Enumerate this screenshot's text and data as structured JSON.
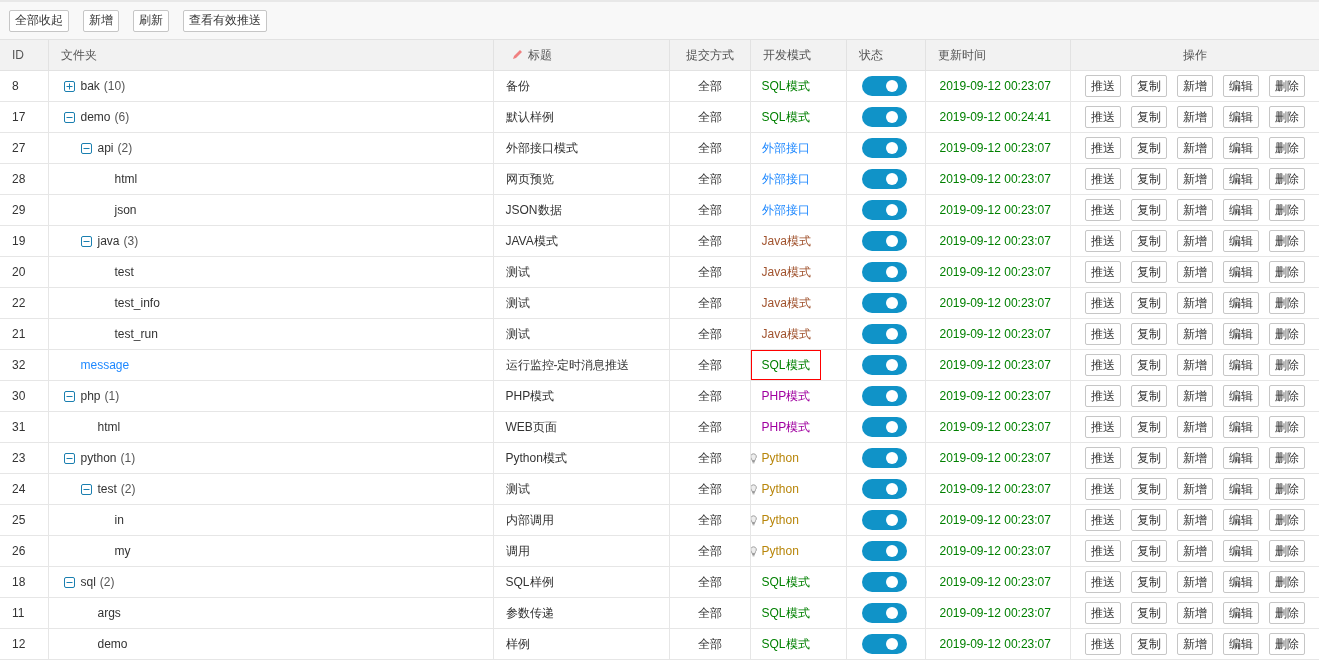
{
  "toolbar": [
    "全部收起",
    "新增",
    "刷新",
    "查看有效推送"
  ],
  "columns": [
    "ID",
    "文件夹",
    "标题",
    "提交方式",
    "开发模式",
    "状态",
    "更新时间",
    "操作"
  ],
  "rows": [
    {
      "id": "8",
      "name": "bak",
      "count": "(10)",
      "expanded": false,
      "link": false,
      "title": "备份",
      "submit": "全部",
      "mode": {
        "kind": "sql",
        "text": "SQL模式"
      },
      "mode_boxed": false,
      "on": true,
      "time": "2019-09-12 00:23:07",
      "actions": [
        "推送",
        "复制",
        "新增",
        "编辑",
        "删除"
      ]
    },
    {
      "id": "17",
      "name": "demo",
      "count": "(6)",
      "expanded": true,
      "link": false,
      "title": "默认样例",
      "submit": "全部",
      "mode": {
        "kind": "sql",
        "text": "SQL模式"
      },
      "mode_boxed": false,
      "on": true,
      "time": "2019-09-12 00:24:41",
      "actions": [
        "推送",
        "复制",
        "新增",
        "编辑",
        "删除"
      ],
      "children": [
        {
          "id": "27",
          "name": "api",
          "count": "(2)",
          "expanded": true,
          "link": false,
          "title": "外部接口模式",
          "submit": "全部",
          "mode": {
            "kind": "api",
            "text": "外部接口"
          },
          "mode_boxed": false,
          "on": true,
          "time": "2019-09-12 00:23:07",
          "actions": [
            "推送",
            "复制",
            "新增",
            "编辑",
            "删除"
          ],
          "children": [
            {
              "id": "28",
              "name": "html",
              "link": false,
              "title": "网页预览",
              "submit": "全部",
              "mode": {
                "kind": "api",
                "text": "外部接口"
              },
              "mode_boxed": false,
              "on": true,
              "time": "2019-09-12 00:23:07",
              "actions": [
                "推送",
                "复制",
                "新增",
                "编辑",
                "删除"
              ]
            },
            {
              "id": "29",
              "name": "json",
              "link": false,
              "title": "JSON数据",
              "submit": "全部",
              "mode": {
                "kind": "api",
                "text": "外部接口"
              },
              "mode_boxed": false,
              "on": true,
              "time": "2019-09-12 00:23:07",
              "actions": [
                "推送",
                "复制",
                "新增",
                "编辑",
                "删除"
              ]
            }
          ]
        },
        {
          "id": "19",
          "name": "java",
          "count": "(3)",
          "expanded": true,
          "link": false,
          "title": "JAVA模式",
          "submit": "全部",
          "mode": {
            "kind": "java",
            "text": "Java模式"
          },
          "mode_boxed": false,
          "on": true,
          "time": "2019-09-12 00:23:07",
          "actions": [
            "推送",
            "复制",
            "新增",
            "编辑",
            "删除"
          ],
          "children": [
            {
              "id": "20",
              "name": "test",
              "link": false,
              "title": "测试",
              "submit": "全部",
              "mode": {
                "kind": "java",
                "text": "Java模式"
              },
              "mode_boxed": false,
              "on": true,
              "time": "2019-09-12 00:23:07",
              "actions": [
                "推送",
                "复制",
                "新增",
                "编辑",
                "删除"
              ]
            },
            {
              "id": "22",
              "name": "test_info",
              "link": false,
              "title": "测试",
              "submit": "全部",
              "mode": {
                "kind": "java",
                "text": "Java模式"
              },
              "mode_boxed": false,
              "on": true,
              "time": "2019-09-12 00:23:07",
              "actions": [
                "推送",
                "复制",
                "新增",
                "编辑",
                "删除"
              ]
            },
            {
              "id": "21",
              "name": "test_run",
              "link": false,
              "title": "测试",
              "submit": "全部",
              "mode": {
                "kind": "java",
                "text": "Java模式"
              },
              "mode_boxed": false,
              "on": true,
              "time": "2019-09-12 00:23:07",
              "actions": [
                "推送",
                "复制",
                "新增",
                "编辑",
                "删除"
              ]
            }
          ]
        }
      ]
    },
    {
      "id": "32",
      "name": "message",
      "link": true,
      "title": "运行监控-定时消息推送",
      "submit": "全部",
      "mode": {
        "kind": "sql",
        "text": "SQL模式"
      },
      "mode_boxed": true,
      "on": true,
      "time": "2019-09-12 00:23:07",
      "actions": [
        "推送",
        "复制",
        "新增",
        "编辑",
        "删除"
      ]
    },
    {
      "id": "30",
      "name": "php",
      "count": "(1)",
      "expanded": true,
      "link": false,
      "title": "PHP模式",
      "submit": "全部",
      "mode": {
        "kind": "php",
        "text": "PHP模式"
      },
      "mode_boxed": false,
      "on": true,
      "time": "2019-09-12 00:23:07",
      "actions": [
        "推送",
        "复制",
        "新增",
        "编辑",
        "删除"
      ],
      "children": [
        {
          "id": "31",
          "name": "html",
          "link": false,
          "title": "WEB页面",
          "submit": "全部",
          "mode": {
            "kind": "php",
            "text": "PHP模式"
          },
          "mode_boxed": false,
          "on": true,
          "time": "2019-09-12 00:23:07",
          "actions": [
            "推送",
            "复制",
            "新增",
            "编辑",
            "删除"
          ]
        }
      ]
    },
    {
      "id": "23",
      "name": "python",
      "count": "(1)",
      "expanded": true,
      "link": false,
      "title": "Python模式",
      "submit": "全部",
      "mode": {
        "kind": "python",
        "text": "Python"
      },
      "mode_boxed": false,
      "on": true,
      "time": "2019-09-12 00:23:07",
      "actions": [
        "推送",
        "复制",
        "新增",
        "编辑",
        "删除"
      ],
      "children": [
        {
          "id": "24",
          "name": "test",
          "count": "(2)",
          "expanded": true,
          "link": false,
          "title": "测试",
          "submit": "全部",
          "mode": {
            "kind": "python",
            "text": "Python"
          },
          "mode_boxed": false,
          "on": true,
          "time": "2019-09-12 00:23:07",
          "actions": [
            "推送",
            "复制",
            "新增",
            "编辑",
            "删除"
          ],
          "children": [
            {
              "id": "25",
              "name": "in",
              "link": false,
              "title": "内部调用",
              "submit": "全部",
              "mode": {
                "kind": "python",
                "text": "Python"
              },
              "mode_boxed": false,
              "on": true,
              "time": "2019-09-12 00:23:07",
              "actions": [
                "推送",
                "复制",
                "新增",
                "编辑",
                "删除"
              ]
            },
            {
              "id": "26",
              "name": "my",
              "link": false,
              "title": "调用",
              "submit": "全部",
              "mode": {
                "kind": "python",
                "text": "Python"
              },
              "mode_boxed": false,
              "on": true,
              "time": "2019-09-12 00:23:07",
              "actions": [
                "推送",
                "复制",
                "新增",
                "编辑",
                "删除"
              ]
            }
          ]
        }
      ]
    },
    {
      "id": "18",
      "name": "sql",
      "count": "(2)",
      "expanded": true,
      "link": false,
      "title": "SQL样例",
      "submit": "全部",
      "mode": {
        "kind": "sql",
        "text": "SQL模式"
      },
      "mode_boxed": false,
      "on": true,
      "time": "2019-09-12 00:23:07",
      "actions": [
        "推送",
        "复制",
        "新增",
        "编辑",
        "删除"
      ],
      "children": [
        {
          "id": "11",
          "name": "args",
          "link": false,
          "title": "参数传递",
          "submit": "全部",
          "mode": {
            "kind": "sql",
            "text": "SQL模式"
          },
          "mode_boxed": false,
          "on": true,
          "time": "2019-09-12 00:23:07",
          "actions": [
            "推送",
            "复制",
            "新增",
            "编辑",
            "删除"
          ]
        },
        {
          "id": "12",
          "name": "demo",
          "link": false,
          "title": "样例",
          "submit": "全部",
          "mode": {
            "kind": "sql",
            "text": "SQL模式"
          },
          "mode_boxed": false,
          "on": true,
          "time": "2019-09-12 00:23:07",
          "actions": [
            "推送",
            "复制",
            "新增",
            "编辑",
            "删除"
          ]
        }
      ]
    }
  ]
}
